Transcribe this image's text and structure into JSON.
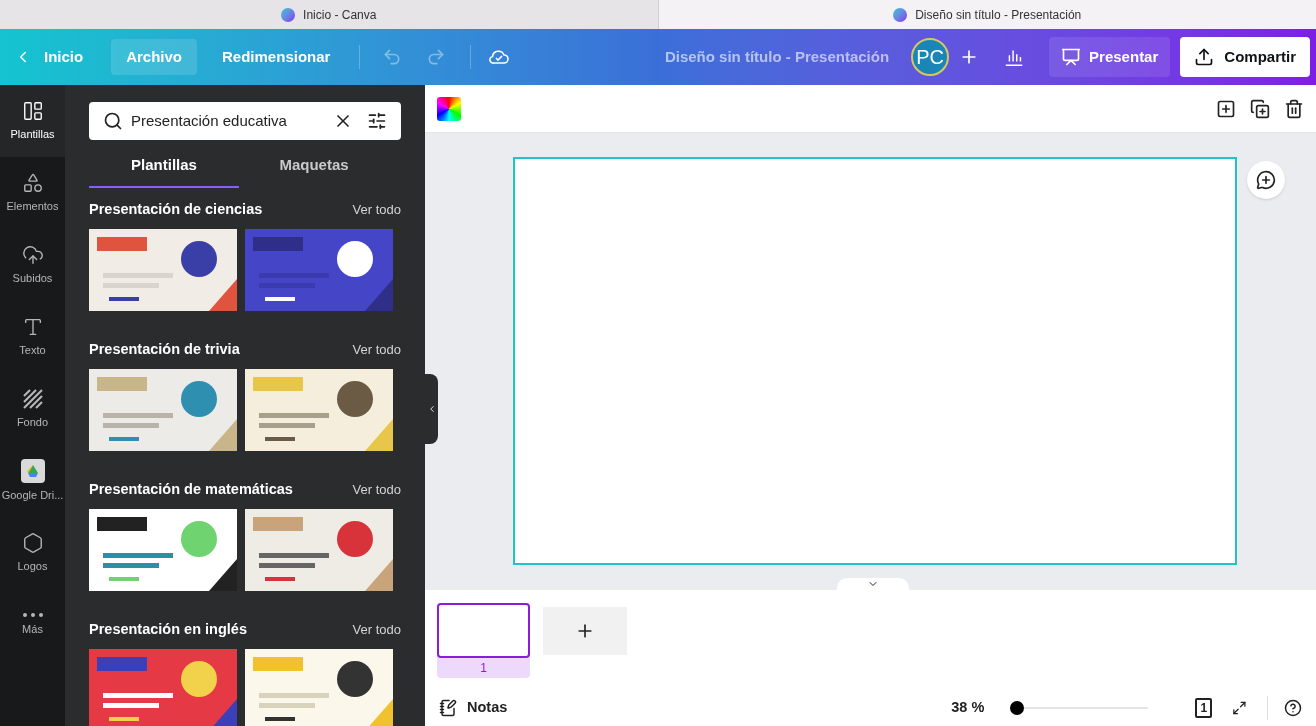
{
  "browser_tabs": [
    {
      "title": "Inicio - Canva",
      "selected": false
    },
    {
      "title": "Diseño sin título - Presentación",
      "selected": true
    }
  ],
  "header": {
    "back": "Inicio",
    "menu": [
      {
        "label": "Archivo",
        "selected": true
      },
      {
        "label": "Redimensionar",
        "selected": false
      }
    ],
    "title": "Diseño sin título - Presentación",
    "avatar": "PC",
    "present": "Presentar",
    "share": "Compartir"
  },
  "rail": [
    {
      "label": "Plantillas",
      "kind": "templates",
      "selected": true
    },
    {
      "label": "Elementos",
      "kind": "elements",
      "selected": false
    },
    {
      "label": "Subidos",
      "kind": "uploads",
      "selected": false
    },
    {
      "label": "Texto",
      "kind": "text",
      "selected": false
    },
    {
      "label": "Fondo",
      "kind": "background",
      "selected": false
    },
    {
      "label": "Google Dri...",
      "kind": "drive",
      "selected": false
    },
    {
      "label": "Logos",
      "kind": "logos",
      "selected": false
    },
    {
      "label": "Más",
      "kind": "more",
      "selected": false
    }
  ],
  "search": {
    "value": "Presentación educativa"
  },
  "panel_tabs": [
    {
      "label": "Plantillas",
      "selected": true
    },
    {
      "label": "Maquetas",
      "selected": false
    }
  ],
  "sections": [
    {
      "title": "Presentación de ciencias",
      "link": "Ver todo"
    },
    {
      "title": "Presentación de trivia",
      "link": "Ver todo"
    },
    {
      "title": "Presentación de matemáticas",
      "link": "Ver todo"
    },
    {
      "title": "Presentación en inglés",
      "link": "Ver todo"
    }
  ],
  "pages": [
    {
      "number": "1",
      "selected": true
    }
  ],
  "footer": {
    "notes": "Notas",
    "zoom": "38 %",
    "level": 0,
    "page_count": "1"
  }
}
